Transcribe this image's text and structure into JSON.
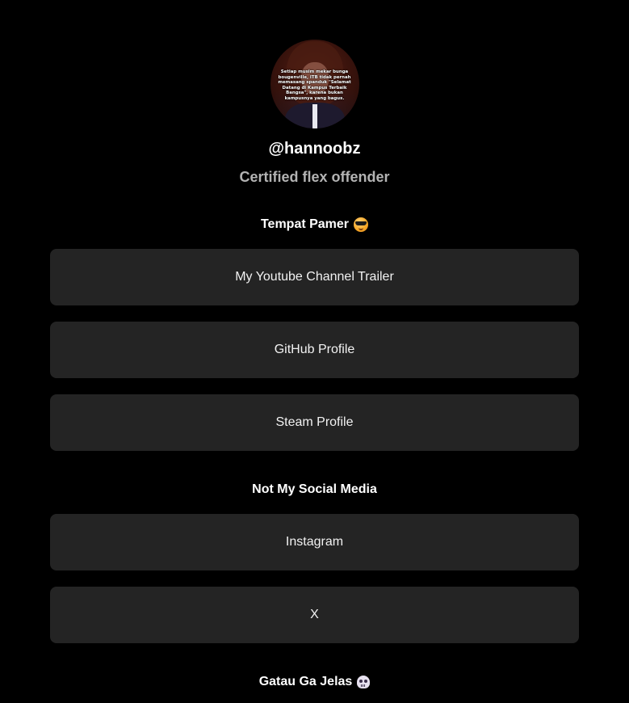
{
  "profile": {
    "avatar_quote": "Setiap musim mekar bunga bougenville, ITB tidak pernah memasang spanduk \"Selamat Datang di Kampus Terbaik Bangsa\", karena bukan kampusnya yang bagus.",
    "username": "@hannoobz",
    "bio": "Certified flex offender"
  },
  "sections": [
    {
      "title": "Tempat Pamer",
      "icon": "sunglasses-face-emoji",
      "links": [
        "My Youtube Channel Trailer",
        "GitHub Profile",
        "Steam Profile"
      ]
    },
    {
      "title": "Not My Social Media",
      "links": [
        "Instagram",
        "X"
      ]
    },
    {
      "title": "Gatau Ga Jelas",
      "icon": "skull-emoji",
      "links": []
    }
  ],
  "colors": {
    "background": "#000000",
    "button_bg": "#242424",
    "bio_text": "#b3b3b3"
  }
}
